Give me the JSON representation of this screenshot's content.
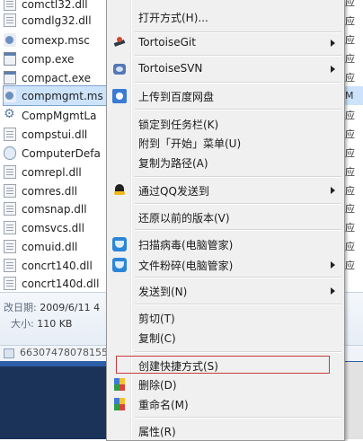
{
  "files": [
    {
      "name": "comctl32.dll",
      "icon": "dll"
    },
    {
      "name": "comdlg32.dll",
      "icon": "dll"
    },
    {
      "name": "comexp.msc",
      "icon": "msc"
    },
    {
      "name": "comp.exe",
      "icon": "exe"
    },
    {
      "name": "compact.exe",
      "icon": "exe"
    },
    {
      "name": "compmgmt.ms",
      "icon": "msc",
      "selected": true
    },
    {
      "name": "CompMgmtLa",
      "icon": "gear"
    },
    {
      "name": "compstui.dll",
      "icon": "dll"
    },
    {
      "name": "ComputerDefa",
      "icon": "cfg"
    },
    {
      "name": "comrepl.dll",
      "icon": "dll"
    },
    {
      "name": "comres.dll",
      "icon": "dll"
    },
    {
      "name": "comsnap.dll",
      "icon": "dll"
    },
    {
      "name": "comsvcs.dll",
      "icon": "dll"
    },
    {
      "name": "comuid.dll",
      "icon": "dll"
    },
    {
      "name": "concrt140.dll",
      "icon": "dll"
    },
    {
      "name": "concrt140d.dll",
      "icon": "dll"
    }
  ],
  "right_column": [
    "应",
    "应",
    "应",
    "应",
    "应",
    "M",
    "应",
    "应",
    "应",
    "应",
    "应",
    "应",
    "应",
    "应",
    "应"
  ],
  "details": {
    "modified_label": "改日期:",
    "modified_value": "2009/6/11 4",
    "size_label": "大小:",
    "size_value": "110 KB"
  },
  "address_text": "66307478078155",
  "menu": {
    "top_partial": "打开方式(H)...",
    "items": [
      {
        "key": "tortoisegit",
        "label": "TortoiseGit",
        "submenu": true,
        "icon": "tortoisegit-icon"
      },
      {
        "key": "tortoisesvn",
        "label": "TortoiseSVN",
        "submenu": true,
        "icon": "tortoisesvn-icon"
      },
      {
        "key": "baidu",
        "label": "上传到百度网盘",
        "submenu": false,
        "icon": "baidu-netdisk-icon"
      },
      {
        "key": "pin-taskbar",
        "label": "锁定到任务栏(K)",
        "submenu": false
      },
      {
        "key": "pin-start",
        "label": "附到「开始」菜单(U)",
        "submenu": false
      },
      {
        "key": "copy-path",
        "label": "复制为路径(A)",
        "submenu": false
      },
      {
        "key": "qq-send",
        "label": "通过QQ发送到",
        "submenu": true,
        "icon": "qq-icon"
      },
      {
        "key": "restore",
        "label": "还原以前的版本(V)",
        "submenu": false
      },
      {
        "key": "scan",
        "label": "扫描病毒(电脑管家)",
        "submenu": false,
        "icon": "shield-icon"
      },
      {
        "key": "shred",
        "label": "文件粉碎(电脑管家)",
        "submenu": true,
        "icon": "shield-icon"
      },
      {
        "key": "send-to",
        "label": "发送到(N)",
        "submenu": true
      },
      {
        "key": "cut",
        "label": "剪切(T)",
        "submenu": false
      },
      {
        "key": "copy",
        "label": "复制(C)",
        "submenu": false
      },
      {
        "key": "shortcut",
        "label": "创建快捷方式(S)",
        "submenu": false,
        "hover": true
      },
      {
        "key": "delete",
        "label": "删除(D)",
        "submenu": false,
        "icon": "uac-shield-icon"
      },
      {
        "key": "rename",
        "label": "重命名(M)",
        "submenu": false,
        "icon": "uac-shield-icon"
      },
      {
        "key": "properties",
        "label": "属性(R)",
        "submenu": false
      }
    ]
  },
  "colors": {
    "selection": "#cde3fb",
    "menu_bg": "#f0f0f0",
    "hover_border": "#c93b3b"
  }
}
